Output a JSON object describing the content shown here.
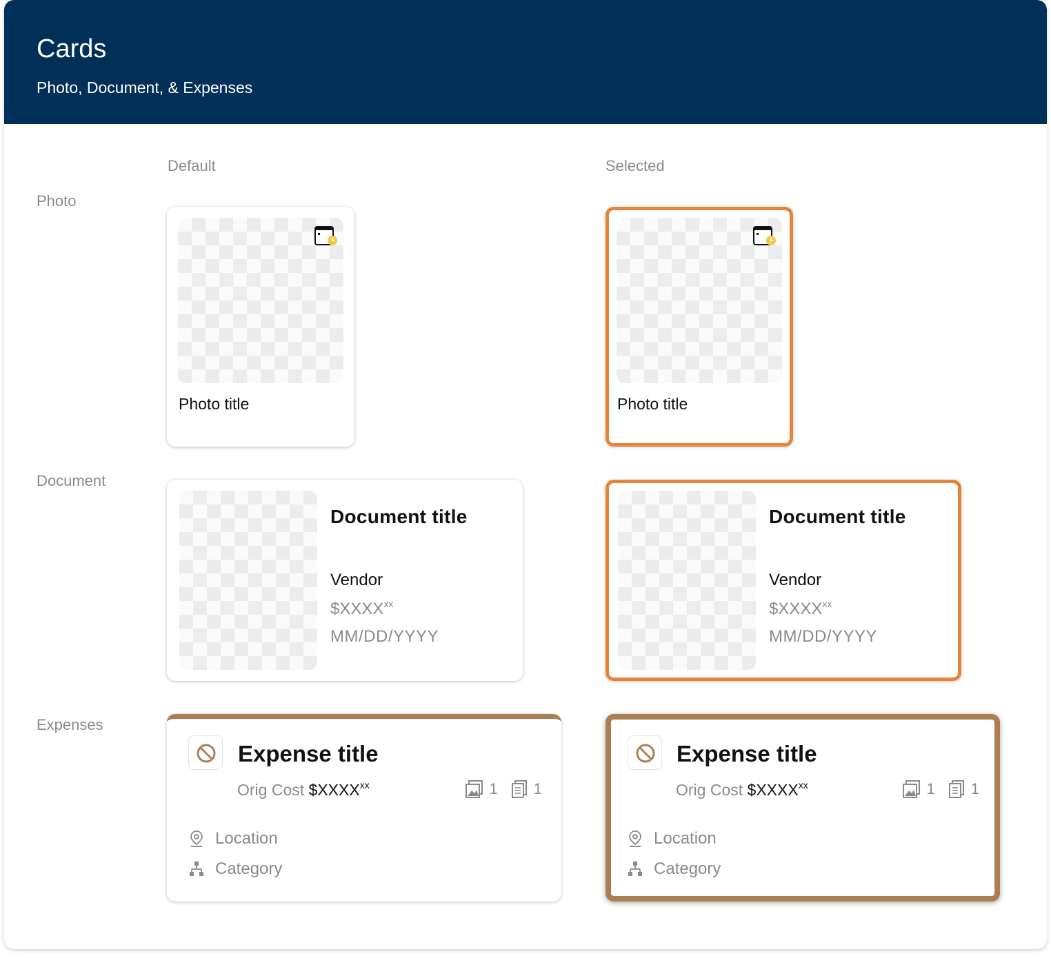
{
  "header": {
    "title": "Cards",
    "subtitle": "Photo, Document, & Expenses"
  },
  "columns": {
    "default": "Default",
    "selected": "Selected"
  },
  "rows": {
    "photo": "Photo",
    "document": "Document",
    "expenses": "Expenses"
  },
  "photo_card": {
    "title": "Photo title"
  },
  "document_card": {
    "title": "Document title",
    "vendor": "Vendor",
    "cost": "$XXXX",
    "cost_cents": "xx",
    "date": "MM/DD/YYYY"
  },
  "expense_card": {
    "title": "Expense title",
    "orig_cost_label": "Orig Cost",
    "cost": "$XXXX",
    "cost_cents": "xx",
    "photo_count": "1",
    "doc_count": "1",
    "location": "Location",
    "category": "Category"
  },
  "colors": {
    "header_bg": "#003057",
    "selected_border": "#e8833a",
    "expense_accent": "#ab7f52",
    "badge_yellow": "#f2c94c"
  }
}
